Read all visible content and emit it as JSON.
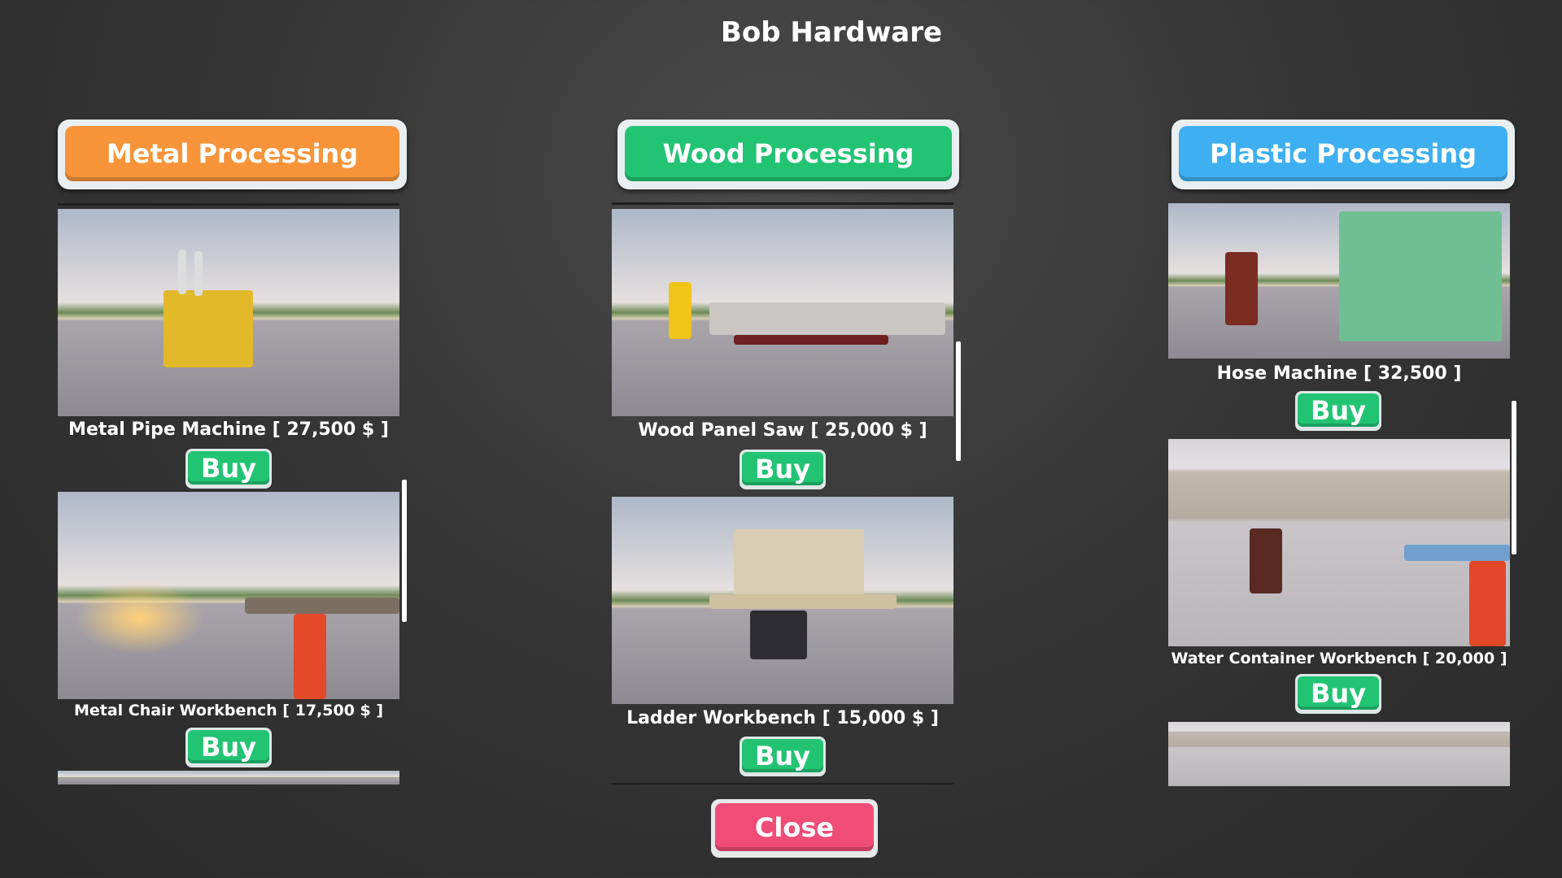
{
  "title": "Bob Hardware",
  "colors": {
    "metal": "#f7943a",
    "wood": "#22c474",
    "plastic": "#3eaff0",
    "buy": "#22c474",
    "close": "#ef4d78"
  },
  "categories": [
    {
      "label": "Metal Processing",
      "items": [
        {
          "name": "Metal Pipe Machine [ 27,500 $ ]",
          "buy": "Buy"
        },
        {
          "name": "Metal Chair Workbench [ 17,500 $ ]",
          "buy": "Buy"
        }
      ]
    },
    {
      "label": "Wood Processing",
      "items": [
        {
          "name": "Wood Panel Saw [ 25,000 $ ]",
          "buy": "Buy"
        },
        {
          "name": "Ladder Workbench [ 15,000 $ ]",
          "buy": "Buy"
        }
      ]
    },
    {
      "label": "Plastic Processing",
      "items": [
        {
          "name": "Hose Machine [ 32,500 ]",
          "buy": "Buy"
        },
        {
          "name": "Water Container Workbench [ 20,000 ]",
          "buy": "Buy"
        }
      ]
    }
  ],
  "close": "Close"
}
